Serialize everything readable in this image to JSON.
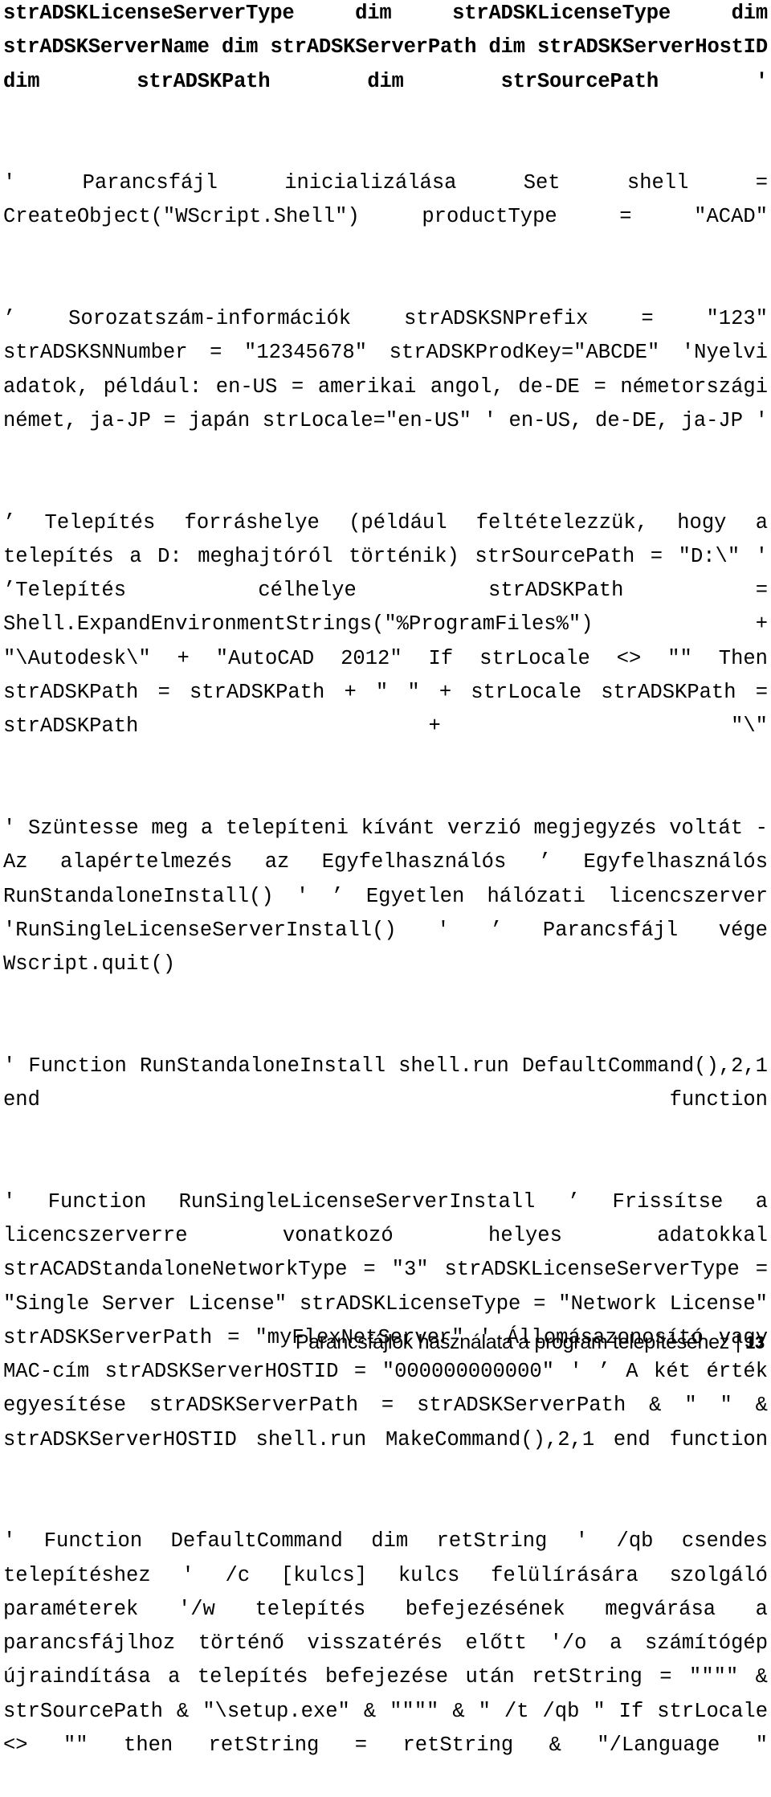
{
  "document": {
    "language": "hu",
    "type": "code-listing-page",
    "footer": {
      "section_title": "Parancsfájlok használata a program telepítéséhez",
      "separator": "|",
      "page_number": "13"
    },
    "blocks": [
      {
        "id": "block-dim-declarations",
        "style": "heavy",
        "text": "strADSKLicenseServerType dim strADSKLicenseType dim strADSKServerName dim strADSKServerPath dim strADSKServerHostID dim strADSKPath dim strSourcePath '"
      },
      {
        "id": "block-init-script",
        "style": "normal",
        "text": "' Parancsfájl inicializálása Set shell = CreateObject(\"WScript.Shell\") productType = \"ACAD\""
      },
      {
        "id": "block-serial-number-info",
        "style": "normal",
        "text": "’ Sorozatszám-információk strADSKSNPrefix = \"123\" strADSKSNNumber = \"12345678\" strADSKProdKey=\"ABCDE\" 'Nyelvi adatok, például: en-US = amerikai angol, de-DE = németországi német, ja-JP = japán strLocale=\"en-US\" ' en-US, de-DE, ja-JP '"
      },
      {
        "id": "block-install-source-and-target",
        "style": "normal",
        "text": "’ Telepítés forráshelye (például feltételezzük, hogy a telepítés a D: meghajtóról történik) strSourcePath = \"D:\\\" ' ’Telepítés célhelye strADSKPath = Shell.ExpandEnvironmentStrings(\"%ProgramFiles%\") + \"\\Autodesk\\\" + \"AutoCAD 2012\" If strLocale <> \"\" Then strADSKPath = strADSKPath + \" \" + strLocale strADSKPath = strADSKPath + \"\\\""
      },
      {
        "id": "block-uncomment-version",
        "style": "normal",
        "text": "' Szüntesse meg a telepíteni kívánt verzió megjegyzés voltát - Az alapértelmezés az Egyfelhasználós ’ Egyfelhasználós RunStandaloneInstall() ' ’ Egyetlen hálózati licencszerver 'RunSingleLicenseServerInstall() ' ’ Parancsfájl vége Wscript.quit()"
      },
      {
        "id": "block-run-standalone-install",
        "style": "normal",
        "text": "' Function RunStandaloneInstall shell.run DefaultCommand(),2,1 end function"
      },
      {
        "id": "block-run-single-license-server-install",
        "style": "normal",
        "text": "' Function RunSingleLicenseServerInstall ’ Frissítse a licencszerverre vonatkozó helyes adatokkal strACADStandaloneNetworkType = \"3\" strADSKLicenseServerType = \"Single Server License\" strADSKLicenseType = \"Network License\" strADSKServerPath = \"myFlexNetServer\" ' Állomásazonosító vagy MAC-cím strADSKServerHOSTID = \"000000000000\" ' ’ A két érték egyesítése strADSKServerPath = strADSKServerPath & \" \" & strADSKServerHOSTID shell.run MakeCommand(),2,1 end function"
      },
      {
        "id": "block-default-command",
        "style": "normal",
        "text": "' Function DefaultCommand dim retString ' /qb csendes telepítéshez ' /c [kulcs] kulcs felülírására szolgáló paraméterek '/w telepítés befejezésének megvárása a parancsfájlhoz történő visszatérés előtt '/o a számítógép újraindítása a telepítés befejezése után retString = \"\"\"\" & strSourcePath & \"\\setup.exe\" & \"\"\"\" & \" /t /qb \" If strLocale <> \"\" then retString = retString & \"/Language \""
      }
    ]
  }
}
